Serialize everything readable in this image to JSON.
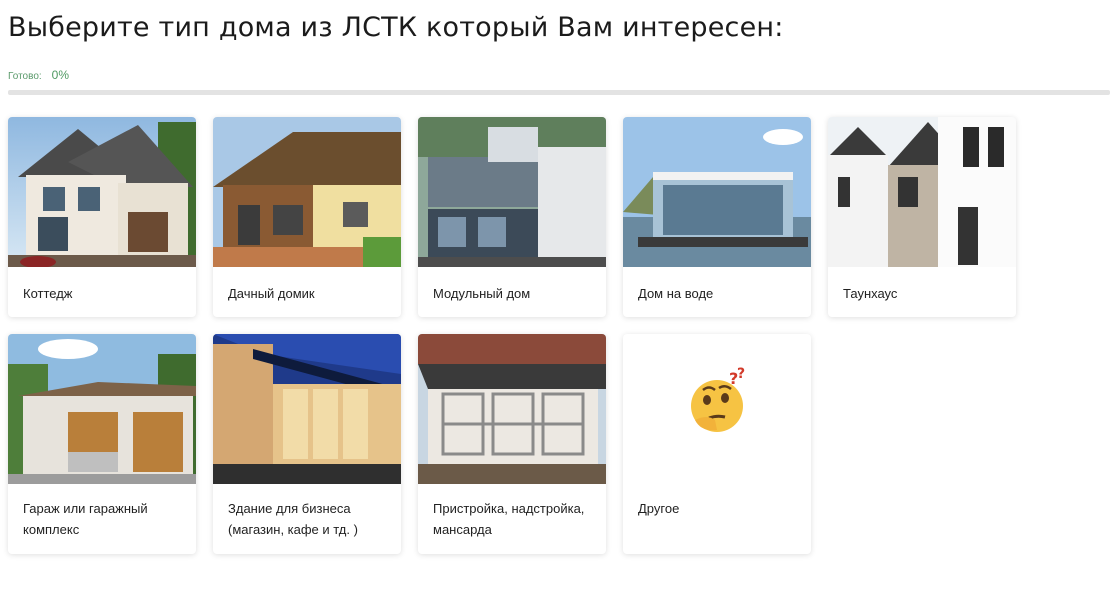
{
  "title": "Выберите тип дома из ЛСТК который Вам интересен:",
  "progress": {
    "label": "Готово:",
    "value_text": "0%",
    "value": 0,
    "accent": "#4f9a62"
  },
  "options": [
    {
      "label": "Коттедж",
      "image": "cottage-image"
    },
    {
      "label": "Дачный домик",
      "image": "country-house-image"
    },
    {
      "label": "Модульный дом",
      "image": "modular-house-image"
    },
    {
      "label": "Дом на воде",
      "image": "floating-house-image"
    },
    {
      "label": "Таунхаус",
      "image": "townhouse-image"
    },
    {
      "label": "Гараж или гаражный комплекс",
      "image": "garage-image"
    },
    {
      "label": "Здание для бизнеса (магазин, кафе и тд. )",
      "image": "business-building-image"
    },
    {
      "label": "Пристройка, надстройка, мансарда",
      "image": "extension-image"
    },
    {
      "label": "Другое",
      "image": "thinking-face-icon"
    }
  ]
}
